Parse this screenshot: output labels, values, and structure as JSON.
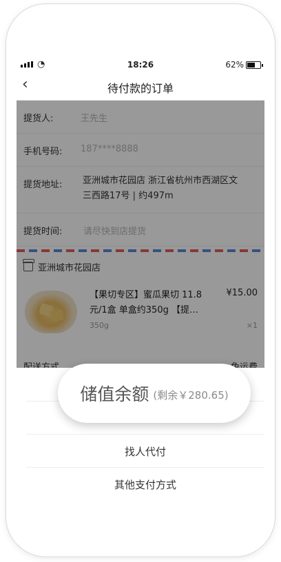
{
  "status_bar": {
    "time": "18:26",
    "battery": "62%"
  },
  "nav": {
    "title": "待付款的订单"
  },
  "form": {
    "pickup_person_label": "提货人:",
    "pickup_person_value": "王先生",
    "phone_label": "手机号码:",
    "phone_value": "187****8888",
    "address_label": "提货地址:",
    "address_line1": "亚洲城市花园店  浙江省杭州市西湖区文",
    "address_line2": "三西路17号 | 约497m",
    "time_label": "提货时间:",
    "time_value": "请尽快到店提货"
  },
  "store": {
    "name": "亚洲城市花园店"
  },
  "product": {
    "name_line1": "【果切专区】蜜瓜果切 11.8",
    "name_line2": "元/1盒 单盒约350g 【提…",
    "spec": "350g",
    "price": "¥15.00",
    "quantity": "×1"
  },
  "delivery": {
    "label": "配送方式",
    "value": "免运费"
  },
  "payment": {
    "balance_label": "储值余额",
    "balance_remaining": "(剩余￥280.65)",
    "option_friend_pay": "找人代付",
    "option_other": "其他支付方式"
  },
  "colors": {
    "airmail_red": "#e35d5d",
    "airmail_blue": "#5b85d6"
  }
}
